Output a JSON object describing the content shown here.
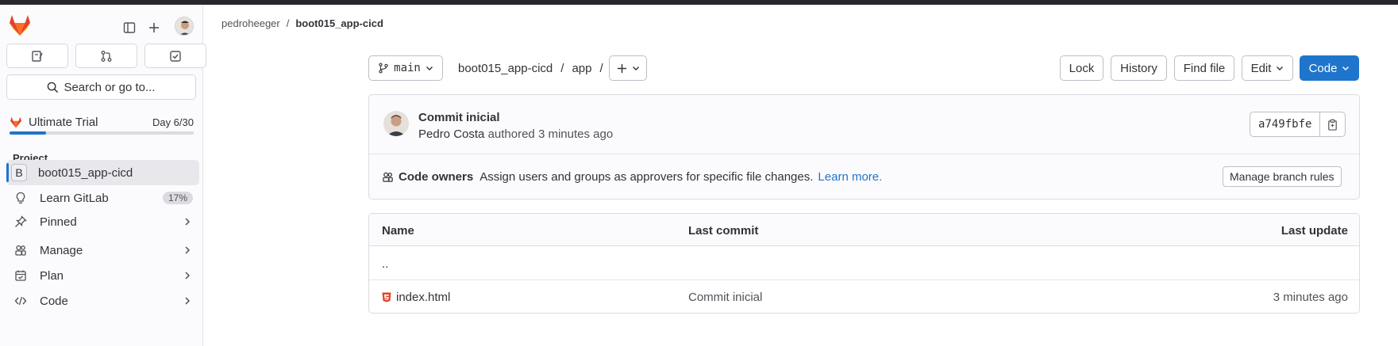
{
  "sidebar": {
    "search_label": "Search or go to...",
    "trial": {
      "label": "Ultimate Trial",
      "day": "Day 6/30",
      "progress": 0.2
    },
    "section_title": "Project",
    "items": [
      {
        "label": "boot015_app-cicd",
        "badge_letter": "B"
      },
      {
        "label": "Learn GitLab",
        "badge": "17%"
      },
      {
        "label": "Pinned"
      },
      {
        "label": "Manage"
      },
      {
        "label": "Plan"
      },
      {
        "label": "Code"
      }
    ]
  },
  "breadcrumb": {
    "owner": "pedroheeger",
    "separator": "/",
    "project": "boot015_app-cicd"
  },
  "toolbar": {
    "branch": "main",
    "path": [
      "boot015_app-cicd",
      "/",
      "app",
      "/"
    ],
    "lock": "Lock",
    "history": "History",
    "find_file": "Find file",
    "edit": "Edit",
    "code": "Code"
  },
  "commit": {
    "title": "Commit inicial",
    "author": "Pedro Costa",
    "meta": "authored 3 minutes ago",
    "sha": "a749fbfe"
  },
  "code_owners": {
    "title": "Code owners",
    "description": "Assign users and groups as approvers for specific file changes.",
    "link": "Learn more.",
    "button": "Manage branch rules"
  },
  "table": {
    "headers": {
      "name": "Name",
      "last_commit": "Last commit",
      "last_update": "Last update"
    },
    "parent": "..",
    "rows": [
      {
        "name": "index.html",
        "last_commit": "Commit inicial",
        "last_update": "3 minutes ago"
      }
    ]
  },
  "colors": {
    "accent": "#1f75cb",
    "topbar": "#28272d",
    "html_icon": "#e24329"
  }
}
